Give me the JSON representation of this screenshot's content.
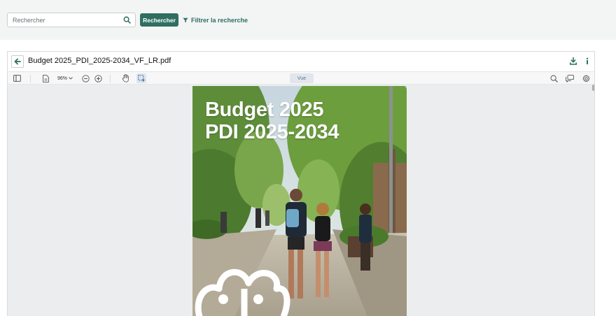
{
  "search": {
    "placeholder": "Rechercher",
    "button_label": "Rechercher",
    "filter_label": "Filtrer la recherche"
  },
  "viewer": {
    "title": "Budget 2025_PDI_2025-2034_VF_LR.pdf",
    "toolbar": {
      "zoom_value": "96%",
      "view_label": "Vue"
    }
  },
  "document": {
    "cover_title_line1": "Budget 2025",
    "cover_title_line2": "PDI 2025-2034"
  },
  "colors": {
    "accent": "#2f6f62",
    "page_background": "#ecedee"
  },
  "icons": {
    "search": "magnifier",
    "filter": "funnel",
    "back": "arrow-left",
    "download": "download-tray",
    "info": "info-i",
    "sidebar": "sidebar-toggle",
    "page_file": "document-page",
    "zoom_out": "circle-minus",
    "zoom_in": "circle-plus",
    "hand": "pan-hand",
    "select": "select-box",
    "find": "magnifier",
    "comments": "speech-bubbles",
    "settings": "gear"
  }
}
